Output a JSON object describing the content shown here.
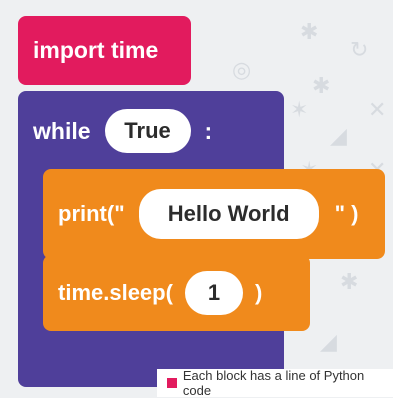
{
  "blocks": {
    "import": {
      "label": "import time"
    },
    "while": {
      "keyword": "while",
      "condition": "True",
      "colon": ":"
    },
    "print": {
      "prefix": "print(\"",
      "value": "Hello World",
      "suffix": "\" )"
    },
    "sleep": {
      "prefix": "time.sleep(",
      "value": "1",
      "suffix": ")"
    }
  },
  "caption": {
    "text": "Each block has a line of Python code"
  },
  "colors": {
    "import": "#e21b5e",
    "while": "#4f3f9a",
    "action": "#f08a1c"
  }
}
